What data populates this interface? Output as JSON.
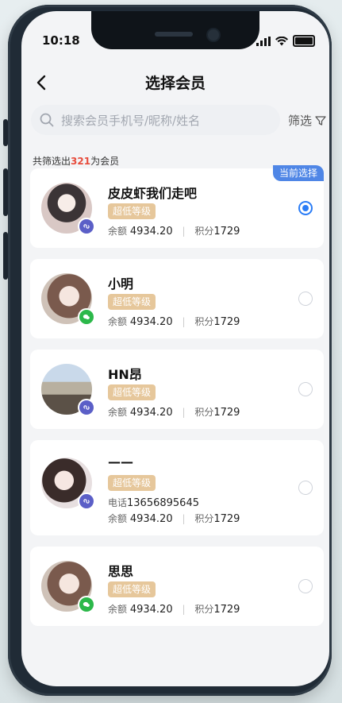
{
  "status": {
    "time": "10:18"
  },
  "header": {
    "title": "选择会员"
  },
  "search": {
    "placeholder": "搜索会员手机号/昵称/姓名",
    "filter_label": "筛选"
  },
  "result": {
    "prefix": "共筛选出",
    "count": "321",
    "suffix": "为会员"
  },
  "current_tag": "当前选择",
  "members": [
    {
      "name": "皮皮虾我们走吧",
      "level": "超低等级",
      "balance_label": "余额",
      "balance": "4934.20",
      "points_label": "积分",
      "points": "1729",
      "selected": true
    },
    {
      "name": "小明",
      "level": "超低等级",
      "balance_label": "余额",
      "balance": "4934.20",
      "points_label": "积分",
      "points": "1729",
      "selected": false
    },
    {
      "name": "HN昂",
      "level": "超低等级",
      "balance_label": "余额",
      "balance": "4934.20",
      "points_label": "积分",
      "points": "1729",
      "selected": false
    },
    {
      "name": "——",
      "level": "超低等级",
      "phone_label": "电话",
      "phone": "13656895645",
      "balance_label": "余额",
      "balance": "4934.20",
      "points_label": "积分",
      "points": "1729",
      "selected": false
    },
    {
      "name": "思思",
      "level": "超低等级",
      "balance_label": "余额",
      "balance": "4934.20",
      "points_label": "积分",
      "points": "1729",
      "selected": false
    }
  ],
  "colors": {
    "accent": "#2a7cf6",
    "level_badge": "#e6c79b",
    "count": "#e74c3c"
  }
}
